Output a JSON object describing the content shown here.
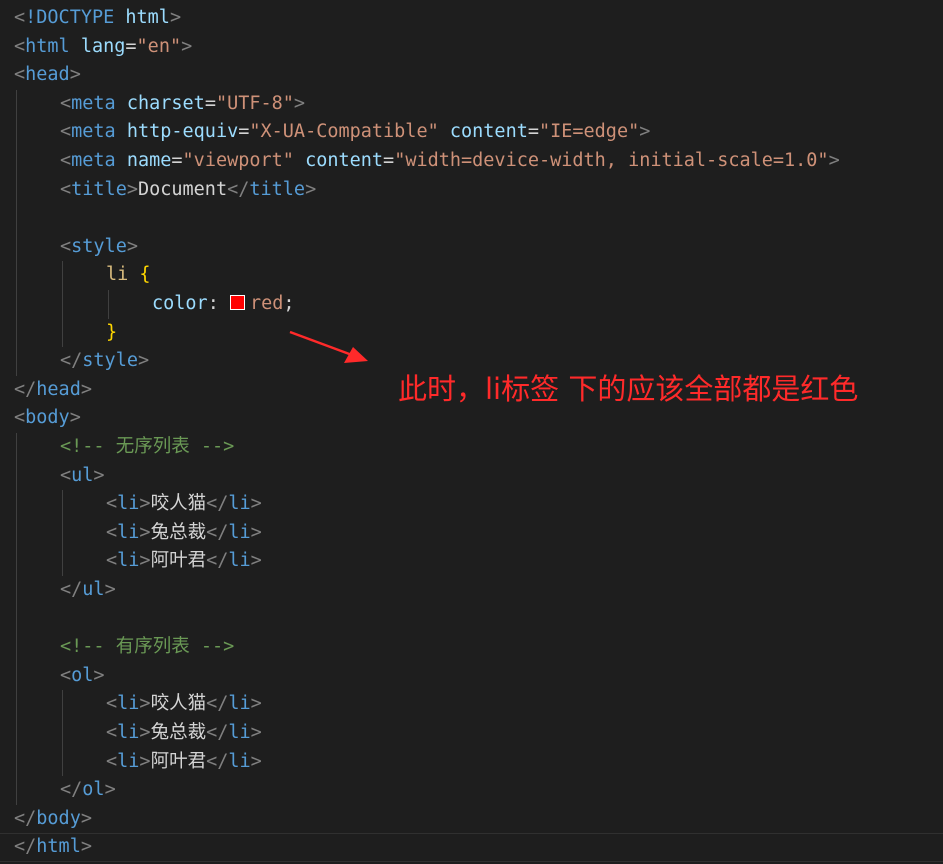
{
  "editor": {
    "lines": [
      {
        "indent": 0,
        "tokens": [
          {
            "t": "bracket",
            "v": "<"
          },
          {
            "t": "tag",
            "v": "!DOCTYPE"
          },
          {
            "t": "text",
            "v": " "
          },
          {
            "t": "attr",
            "v": "html"
          },
          {
            "t": "bracket",
            "v": ">"
          }
        ]
      },
      {
        "indent": 0,
        "tokens": [
          {
            "t": "bracket",
            "v": "<"
          },
          {
            "t": "tag",
            "v": "html"
          },
          {
            "t": "text",
            "v": " "
          },
          {
            "t": "attr",
            "v": "lang"
          },
          {
            "t": "text",
            "v": "="
          },
          {
            "t": "str",
            "v": "\"en\""
          },
          {
            "t": "bracket",
            "v": ">"
          }
        ]
      },
      {
        "indent": 0,
        "tokens": [
          {
            "t": "bracket",
            "v": "<"
          },
          {
            "t": "tag",
            "v": "head"
          },
          {
            "t": "bracket",
            "v": ">"
          }
        ]
      },
      {
        "indent": 1,
        "tokens": [
          {
            "t": "bracket",
            "v": "<"
          },
          {
            "t": "tag",
            "v": "meta"
          },
          {
            "t": "text",
            "v": " "
          },
          {
            "t": "attr",
            "v": "charset"
          },
          {
            "t": "text",
            "v": "="
          },
          {
            "t": "str",
            "v": "\"UTF-8\""
          },
          {
            "t": "bracket",
            "v": ">"
          }
        ]
      },
      {
        "indent": 1,
        "tokens": [
          {
            "t": "bracket",
            "v": "<"
          },
          {
            "t": "tag",
            "v": "meta"
          },
          {
            "t": "text",
            "v": " "
          },
          {
            "t": "attr",
            "v": "http-equiv"
          },
          {
            "t": "text",
            "v": "="
          },
          {
            "t": "str",
            "v": "\"X-UA-Compatible\""
          },
          {
            "t": "text",
            "v": " "
          },
          {
            "t": "attr",
            "v": "content"
          },
          {
            "t": "text",
            "v": "="
          },
          {
            "t": "str",
            "v": "\"IE=edge\""
          },
          {
            "t": "bracket",
            "v": ">"
          }
        ]
      },
      {
        "indent": 1,
        "tokens": [
          {
            "t": "bracket",
            "v": "<"
          },
          {
            "t": "tag",
            "v": "meta"
          },
          {
            "t": "text",
            "v": " "
          },
          {
            "t": "attr",
            "v": "name"
          },
          {
            "t": "text",
            "v": "="
          },
          {
            "t": "str",
            "v": "\"viewport\""
          },
          {
            "t": "text",
            "v": " "
          },
          {
            "t": "attr",
            "v": "content"
          },
          {
            "t": "text",
            "v": "="
          },
          {
            "t": "str",
            "v": "\"width=device-width, initial-scale=1.0\""
          },
          {
            "t": "bracket",
            "v": ">"
          }
        ]
      },
      {
        "indent": 1,
        "tokens": [
          {
            "t": "bracket",
            "v": "<"
          },
          {
            "t": "tag",
            "v": "title"
          },
          {
            "t": "bracket",
            "v": ">"
          },
          {
            "t": "text",
            "v": "Document"
          },
          {
            "t": "bracket",
            "v": "</"
          },
          {
            "t": "tag",
            "v": "title"
          },
          {
            "t": "bracket",
            "v": ">"
          }
        ]
      },
      {
        "indent": 0,
        "tokens": []
      },
      {
        "indent": 1,
        "tokens": [
          {
            "t": "bracket",
            "v": "<"
          },
          {
            "t": "tag",
            "v": "style"
          },
          {
            "t": "bracket",
            "v": ">"
          }
        ]
      },
      {
        "indent": 2,
        "tokens": [
          {
            "t": "sel",
            "v": "li"
          },
          {
            "t": "text",
            "v": " "
          },
          {
            "t": "brace",
            "v": "{"
          }
        ]
      },
      {
        "indent": 3,
        "tokens": [
          {
            "t": "prop",
            "v": "color"
          },
          {
            "t": "text",
            "v": ": "
          },
          {
            "t": "swatch",
            "v": "#ff0000"
          },
          {
            "t": "str",
            "v": "red"
          },
          {
            "t": "text",
            "v": ";"
          }
        ]
      },
      {
        "indent": 2,
        "tokens": [
          {
            "t": "brace",
            "v": "}"
          }
        ]
      },
      {
        "indent": 1,
        "tokens": [
          {
            "t": "bracket",
            "v": "</"
          },
          {
            "t": "tag",
            "v": "style"
          },
          {
            "t": "bracket",
            "v": ">"
          }
        ]
      },
      {
        "indent": 0,
        "tokens": [
          {
            "t": "bracket",
            "v": "</"
          },
          {
            "t": "tag",
            "v": "head"
          },
          {
            "t": "bracket",
            "v": ">"
          }
        ]
      },
      {
        "indent": 0,
        "tokens": [
          {
            "t": "bracket",
            "v": "<"
          },
          {
            "t": "tag",
            "v": "body"
          },
          {
            "t": "bracket",
            "v": ">"
          }
        ]
      },
      {
        "indent": 1,
        "tokens": [
          {
            "t": "comment",
            "v": "<!-- 无序列表 -->"
          }
        ]
      },
      {
        "indent": 1,
        "tokens": [
          {
            "t": "bracket",
            "v": "<"
          },
          {
            "t": "tag",
            "v": "ul"
          },
          {
            "t": "bracket",
            "v": ">"
          }
        ]
      },
      {
        "indent": 2,
        "tokens": [
          {
            "t": "bracket",
            "v": "<"
          },
          {
            "t": "tag",
            "v": "li"
          },
          {
            "t": "bracket",
            "v": ">"
          },
          {
            "t": "cjk",
            "v": "咬人猫"
          },
          {
            "t": "bracket",
            "v": "</"
          },
          {
            "t": "tag",
            "v": "li"
          },
          {
            "t": "bracket",
            "v": ">"
          }
        ]
      },
      {
        "indent": 2,
        "tokens": [
          {
            "t": "bracket",
            "v": "<"
          },
          {
            "t": "tag",
            "v": "li"
          },
          {
            "t": "bracket",
            "v": ">"
          },
          {
            "t": "cjk",
            "v": "兔总裁"
          },
          {
            "t": "bracket",
            "v": "</"
          },
          {
            "t": "tag",
            "v": "li"
          },
          {
            "t": "bracket",
            "v": ">"
          }
        ]
      },
      {
        "indent": 2,
        "tokens": [
          {
            "t": "bracket",
            "v": "<"
          },
          {
            "t": "tag",
            "v": "li"
          },
          {
            "t": "bracket",
            "v": ">"
          },
          {
            "t": "cjk",
            "v": "阿叶君"
          },
          {
            "t": "bracket",
            "v": "</"
          },
          {
            "t": "tag",
            "v": "li"
          },
          {
            "t": "bracket",
            "v": ">"
          }
        ]
      },
      {
        "indent": 1,
        "tokens": [
          {
            "t": "bracket",
            "v": "</"
          },
          {
            "t": "tag",
            "v": "ul"
          },
          {
            "t": "bracket",
            "v": ">"
          }
        ]
      },
      {
        "indent": 0,
        "tokens": []
      },
      {
        "indent": 1,
        "tokens": [
          {
            "t": "comment",
            "v": "<!-- 有序列表 -->"
          }
        ]
      },
      {
        "indent": 1,
        "tokens": [
          {
            "t": "bracket",
            "v": "<"
          },
          {
            "t": "tag",
            "v": "ol"
          },
          {
            "t": "bracket",
            "v": ">"
          }
        ]
      },
      {
        "indent": 2,
        "tokens": [
          {
            "t": "bracket",
            "v": "<"
          },
          {
            "t": "tag",
            "v": "li"
          },
          {
            "t": "bracket",
            "v": ">"
          },
          {
            "t": "cjk",
            "v": "咬人猫"
          },
          {
            "t": "bracket",
            "v": "</"
          },
          {
            "t": "tag",
            "v": "li"
          },
          {
            "t": "bracket",
            "v": ">"
          }
        ]
      },
      {
        "indent": 2,
        "tokens": [
          {
            "t": "bracket",
            "v": "<"
          },
          {
            "t": "tag",
            "v": "li"
          },
          {
            "t": "bracket",
            "v": ">"
          },
          {
            "t": "cjk",
            "v": "兔总裁"
          },
          {
            "t": "bracket",
            "v": "</"
          },
          {
            "t": "tag",
            "v": "li"
          },
          {
            "t": "bracket",
            "v": ">"
          }
        ]
      },
      {
        "indent": 2,
        "tokens": [
          {
            "t": "bracket",
            "v": "<"
          },
          {
            "t": "tag",
            "v": "li"
          },
          {
            "t": "bracket",
            "v": ">"
          },
          {
            "t": "cjk",
            "v": "阿叶君"
          },
          {
            "t": "bracket",
            "v": "</"
          },
          {
            "t": "tag",
            "v": "li"
          },
          {
            "t": "bracket",
            "v": ">"
          }
        ]
      },
      {
        "indent": 1,
        "tokens": [
          {
            "t": "bracket",
            "v": "</"
          },
          {
            "t": "tag",
            "v": "ol"
          },
          {
            "t": "bracket",
            "v": ">"
          }
        ]
      },
      {
        "indent": 0,
        "tokens": [
          {
            "t": "bracket",
            "v": "</"
          },
          {
            "t": "tag",
            "v": "body"
          },
          {
            "t": "bracket",
            "v": ">"
          }
        ]
      },
      {
        "indent": 0,
        "current": true,
        "tokens": [
          {
            "t": "bracket",
            "v": "</"
          },
          {
            "t": "tag",
            "v": "html"
          },
          {
            "t": "bracket",
            "v": ">"
          }
        ]
      }
    ]
  },
  "annotation": {
    "text": "此时，li标签 下的应该全部都是红色",
    "color": "#ff2a2a",
    "icon": "arrow-icon"
  },
  "colors": {
    "background": "#1e1e1e",
    "tag": "#569cd6",
    "attribute": "#9cdcfe",
    "string": "#ce9178",
    "comment": "#6a9955",
    "selector": "#d7ba7d",
    "brace": "#ffd700",
    "bracket": "#808080"
  }
}
